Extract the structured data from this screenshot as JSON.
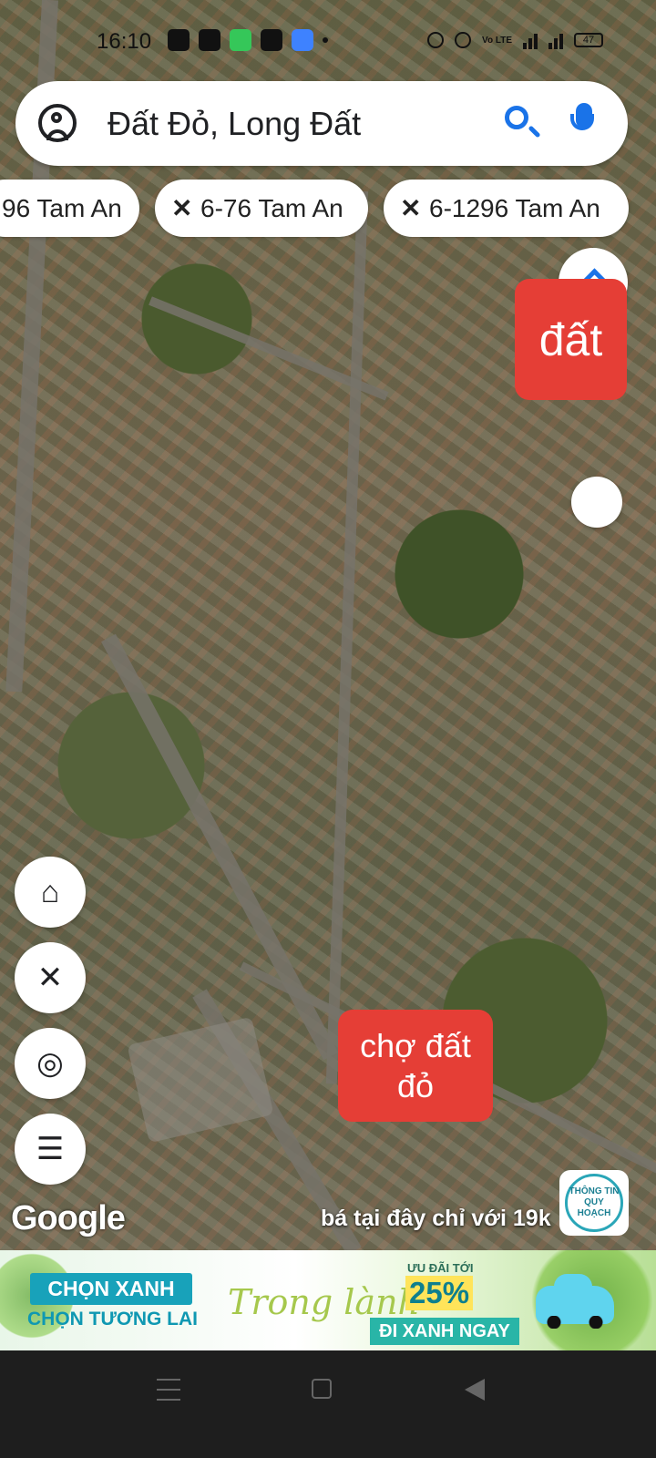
{
  "status_bar": {
    "time": "16:10",
    "battery": "47",
    "network_label": "Vo LTE",
    "notification_icons": [
      "messenger-icon",
      "play-icon",
      "green-app-icon",
      "bao-moi-icon",
      "blue-app-icon",
      "dot-icon"
    ],
    "status_icons": [
      "location-icon",
      "wifi-icon",
      "volte-icon",
      "signal-icon",
      "battery-icon"
    ]
  },
  "search": {
    "query": "Đất Đỏ, Long Đất",
    "left_icon": "account-icon",
    "right_icons": [
      "search-icon",
      "mic-icon"
    ]
  },
  "chips": [
    {
      "label": "96 Tam An",
      "icon": "measure-icon"
    },
    {
      "label": "6-76 Tam An",
      "icon": "measure-icon"
    },
    {
      "label": "6-1296 Tam An",
      "icon": "measure-icon"
    }
  ],
  "map_labels": {
    "top_red_label": "đất",
    "bottom_red_label": "chợ đất đỏ",
    "google_logo": "Google",
    "ad_text": "bá tại đây chỉ với 19k",
    "planning_badge": "THÔNG TIN QUY HOẠCH"
  },
  "tools": [
    "camera-plus-icon",
    "measure-icon",
    "my-location-icon",
    "menu-icon"
  ],
  "banner": {
    "primary": "CHỌN XANH",
    "secondary": "CHỌN TƯƠNG LAI",
    "script": "Trong lành",
    "offer_label": "ƯU ĐÃI TỚI",
    "offer_value": "25%",
    "cta": "ĐI XANH NGAY"
  },
  "navigation": [
    "menu-icon",
    "home-icon",
    "back-icon"
  ]
}
